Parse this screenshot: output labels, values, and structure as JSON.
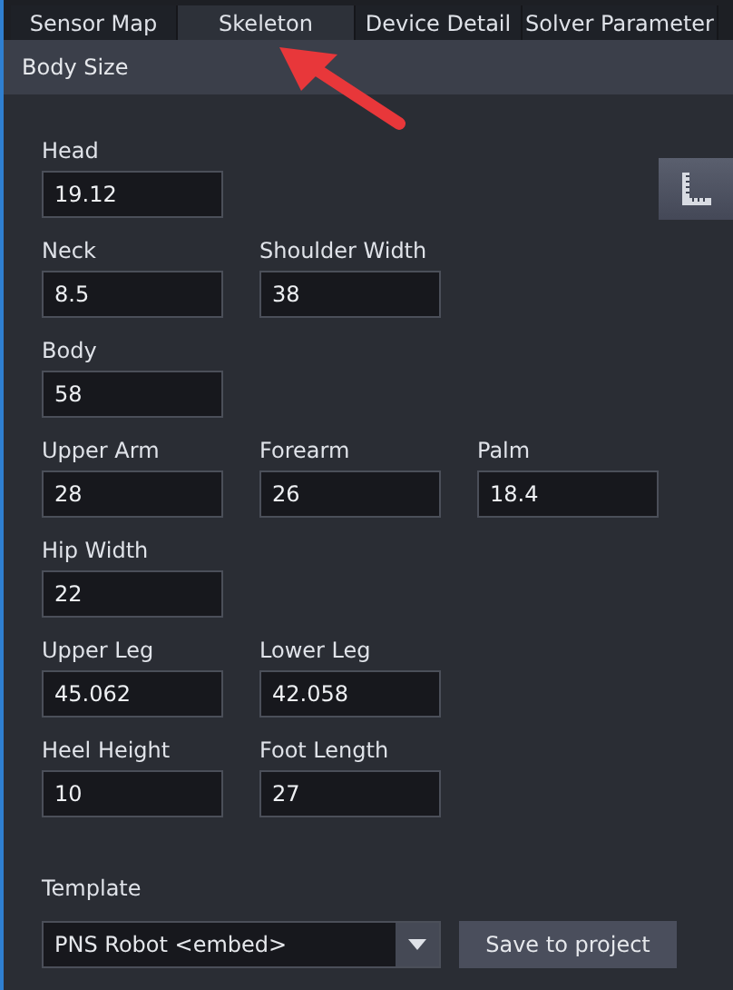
{
  "tabs": [
    {
      "label": "Sensor Map",
      "selected": false
    },
    {
      "label": "Skeleton",
      "selected": true
    },
    {
      "label": "Device Detail",
      "selected": false
    },
    {
      "label": "Solver Parameter",
      "selected": false
    }
  ],
  "section": {
    "title": "Body Size"
  },
  "rows": [
    [
      {
        "label": "Head",
        "value": "19.12"
      }
    ],
    [
      {
        "label": "Neck",
        "value": "8.5"
      },
      {
        "label": "Shoulder Width",
        "value": "38"
      }
    ],
    [
      {
        "label": "Body",
        "value": "58"
      }
    ],
    [
      {
        "label": "Upper Arm",
        "value": "28"
      },
      {
        "label": "Forearm",
        "value": "26"
      },
      {
        "label": "Palm",
        "value": "18.4"
      }
    ],
    [
      {
        "label": "Hip Width",
        "value": "22"
      }
    ],
    [
      {
        "label": "Upper Leg",
        "value": "45.062"
      },
      {
        "label": "Lower Leg",
        "value": "42.058"
      }
    ],
    [
      {
        "label": "Heel Height",
        "value": "10"
      },
      {
        "label": "Foot Length",
        "value": "27"
      }
    ]
  ],
  "template": {
    "label": "Template",
    "value": "PNS Robot <embed>",
    "button": "Save to project"
  }
}
